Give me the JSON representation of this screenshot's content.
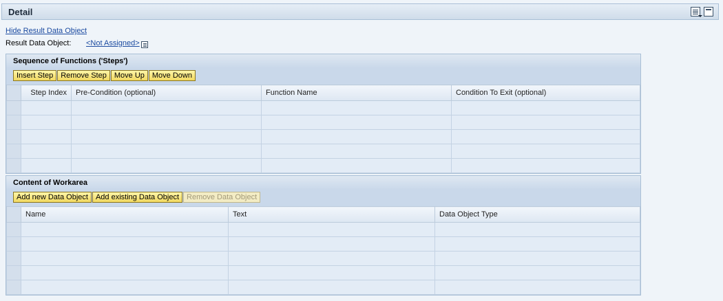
{
  "panel": {
    "title": "Detail"
  },
  "result": {
    "hide_link": "Hide Result Data Object",
    "label": "Result Data Object:",
    "value_link": "<Not Assigned>"
  },
  "steps": {
    "title": "Sequence of Functions ('Steps')",
    "buttons": [
      "Insert Step",
      "Remove Step",
      "Move Up",
      "Move Down"
    ],
    "columns": [
      "Step Index",
      "Pre-Condition (optional)",
      "Function Name",
      "Condition To Exit (optional)"
    ],
    "row_count": 5
  },
  "workarea": {
    "title": "Content of Workarea",
    "buttons": [
      "Add new Data Object",
      "Add existing Data Object",
      "Remove Data Object"
    ],
    "disabled_buttons": [
      "Remove Data Object"
    ],
    "columns": [
      "Name",
      "Text",
      "Data Object Type"
    ],
    "row_count": 5
  },
  "colors": {
    "page_bg": "#eff4f9",
    "button_bg": "#f1d860",
    "link": "#1b4aa0"
  },
  "icons": [
    "list-options-icon",
    "collapse-icon",
    "value-help-icon"
  ]
}
